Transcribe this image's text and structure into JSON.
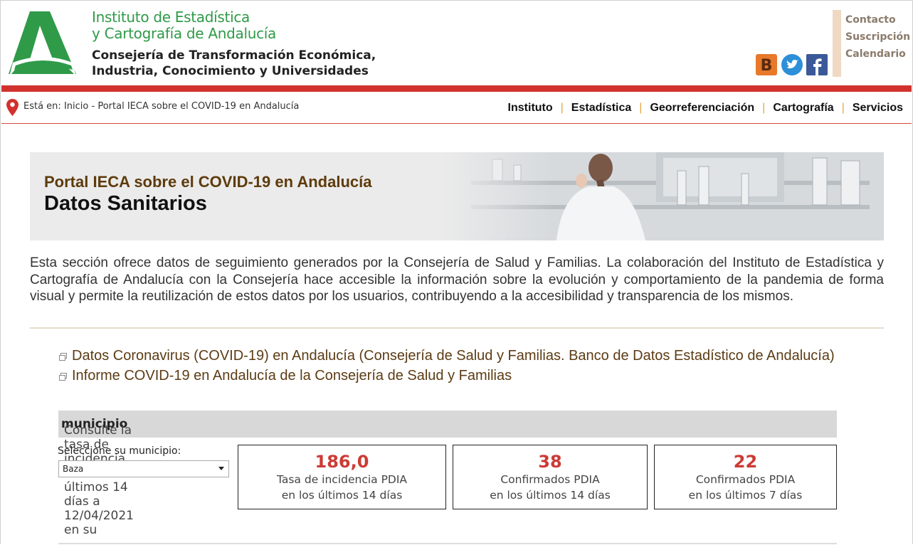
{
  "header": {
    "institute_line1": "Instituto de Estadística",
    "institute_line2": "y Cartografía de Andalucía",
    "consejeria_line1": "Consejería de Transformación Económica,",
    "consejeria_line2": "Industria, Conocimiento y Universidades",
    "top_links": [
      "Contacto",
      "Suscripción",
      "Calendario"
    ],
    "social": [
      "blog-icon",
      "twitter-icon",
      "facebook-icon"
    ]
  },
  "breadcrumb": {
    "prefix": "Está en:",
    "home": "Inicio",
    "separator": "-",
    "current": "Portal IECA sobre el COVID-19 en Andalucía"
  },
  "nav": {
    "items": [
      "Instituto",
      "Estadística",
      "Georreferenciación",
      "Cartografía",
      "Servicios"
    ],
    "separator": "|"
  },
  "banner": {
    "subtitle": "Portal IECA sobre el COVID-19 en Andalucía",
    "title": "Datos Sanitarios"
  },
  "intro": "Esta sección ofrece datos de seguimiento generados por la Consejería de Salud y Familias. La colaboración del Instituto de Estadística y Cartografía de Andalucía con la Consejería hace accesible la información sobre la evolución y comportamiento de la pandemia de forma visual y permite la reutilización de estos datos por los usuarios, contribuyendo a la accesibilidad y transparencia de los mismos.",
  "links": [
    "Datos Coronavirus (COVID-19) en Andalucía (Consejería de Salud y Familias. Banco de Datos Estadístico de Andalucía)",
    "Informe COVID-19 en Andalucía de la Consejería de Salud y Familias"
  ],
  "incidence": {
    "prefix": "Consulte la tasa de incidencia PDIA en los últimos 14 días a 12/04/2021 en su",
    "bold": "municipio",
    "select_label": "Seleccione su municipio:",
    "selected": "Baza"
  },
  "stats": [
    {
      "value": "186,0",
      "line1": "Tasa de incidencia PDIA",
      "line2": "en los últimos 14 días"
    },
    {
      "value": "38",
      "line1": "Confirmados PDIA",
      "line2": "en los últimos 14 días"
    },
    {
      "value": "22",
      "line1": "Confirmados PDIA",
      "line2": "en los últimos 7 días"
    }
  ],
  "colors": {
    "brand_green": "#2f9a48",
    "accent_red": "#d1322e",
    "nav_separator": "#e7a33d",
    "link_brown": "#5c3c14",
    "stat_red": "#cc3b36"
  }
}
